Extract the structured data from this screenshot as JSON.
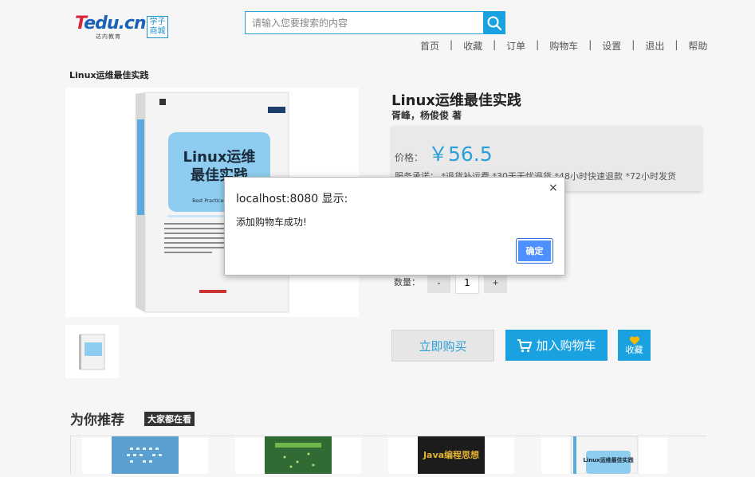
{
  "header": {
    "logo_brand": "Tedu.cn",
    "logo_sub": "达内教育",
    "logo_box": [
      "学子",
      "商城"
    ],
    "search_placeholder": "请输入您要搜索的内容",
    "nav": [
      "首页",
      "收藏",
      "订单",
      "购物车",
      "设置",
      "退出",
      "帮助"
    ],
    "nav_separator": "|"
  },
  "breadcrumb": "Linux运维最佳实践",
  "product": {
    "cover_title": [
      "Linux运维",
      "最佳实践"
    ],
    "cover_subtitle": "Best Practices in Linux",
    "title": "Linux运维最佳实践",
    "author": "胥峰，杨俊俊 著",
    "price_label": "价格：",
    "price": "￥56.5",
    "service_text": "服务承诺：  *退货补运费  *30天无忧退货  *48小时快速退款  *72小时发货",
    "qty_label": "数量：",
    "qty_minus": "-",
    "qty_value": "1",
    "qty_plus": "+",
    "buy_now": "立即购买",
    "add_cart": "加入购物车",
    "collect": "收藏"
  },
  "recommend": {
    "title": "为你推荐",
    "badge": "大家都在看",
    "items": [
      "",
      "",
      "Java编程思想",
      "Linux运维最佳实践"
    ]
  },
  "dialog": {
    "title": "localhost:8080 显示:",
    "message": "添加购物车成功!",
    "ok": "确定",
    "close": "×"
  },
  "colors": {
    "accent": "#1aa1e0",
    "price": "#2aa0d8",
    "dialog_ok": "#4d90fe"
  }
}
